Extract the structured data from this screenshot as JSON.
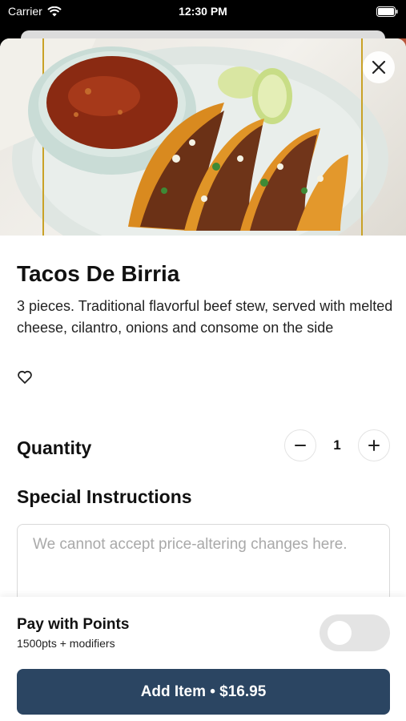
{
  "status_bar": {
    "carrier": "Carrier",
    "time": "12:30 PM"
  },
  "item": {
    "title": "Tacos De Birria",
    "description": "3 pieces. Traditional flavorful beef stew, served with melted cheese, cilantro, onions and consome on the side",
    "image_icon": "food-photo"
  },
  "quantity": {
    "label": "Quantity",
    "value": "1",
    "minus_icon": "minus-icon",
    "plus_icon": "plus-icon"
  },
  "special_instructions": {
    "label": "Special Instructions",
    "value": "",
    "placeholder": "We cannot accept price-altering changes here."
  },
  "footer": {
    "pay_title": "Pay with Points",
    "pay_subtitle": "1500pts + modifiers",
    "toggle_on": false,
    "add_button_label": "Add Item • $16.95"
  },
  "colors": {
    "primary_button": "#2b4562",
    "toggle_off": "#e4e4e4"
  }
}
